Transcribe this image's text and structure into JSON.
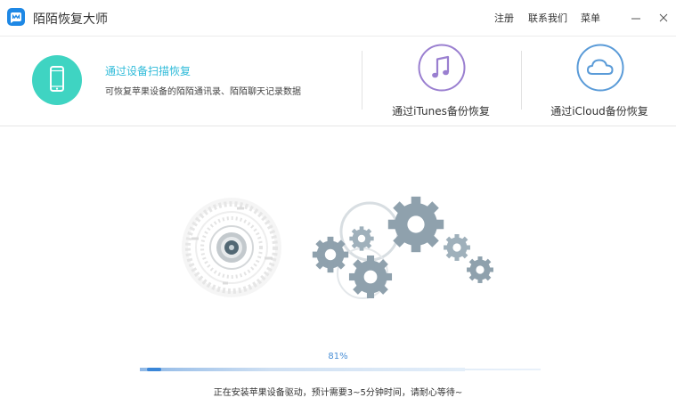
{
  "app": {
    "title": "陌陌恢复大师",
    "logo_icon": "momo-logo-icon",
    "brand_color": "#1e88e5"
  },
  "titlebar": {
    "links": {
      "register": "注册",
      "contact": "联系我们",
      "menu": "菜单"
    },
    "controls": {
      "minimize_icon": "minimize-icon",
      "close_icon": "close-icon"
    }
  },
  "modes": {
    "scan": {
      "title": "通过设备扫描恢复",
      "description": "可恢复苹果设备的陌陌通讯录、陌陌聊天记录数据",
      "icon": "phone-icon",
      "accent_color": "#3fd4c2"
    },
    "itunes": {
      "label": "通过iTunes备份恢复",
      "icon": "music-note-icon",
      "accent_color": "#9a7fd0"
    },
    "icloud": {
      "label": "通过iCloud备份恢复",
      "icon": "cloud-icon",
      "accent_color": "#5a9bd8"
    }
  },
  "progress": {
    "percent_text": "81%",
    "value": 0.81,
    "status_text": "正在安装苹果设备驱动，预计需要3~5分钟时间，请耐心等待~",
    "color": "#3a86d8"
  },
  "illustration": {
    "icon": "gears-illustration-icon"
  }
}
